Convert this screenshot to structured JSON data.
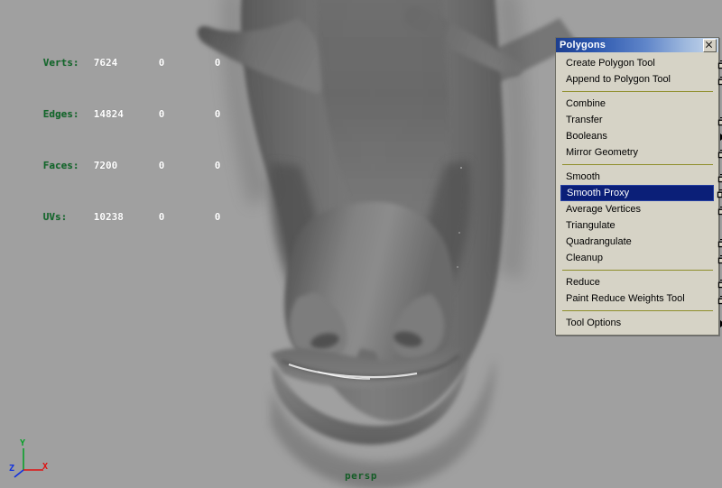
{
  "app": {
    "viewport_background": "#a0a0a0",
    "camera_label": "persp"
  },
  "hud": {
    "rows": [
      {
        "label": "Verts:",
        "v0": "7624",
        "v1": "0",
        "v2": "0"
      },
      {
        "label": "Edges:",
        "v0": "14824",
        "v1": "0",
        "v2": "0"
      },
      {
        "label": "Faces:",
        "v0": "7200",
        "v1": "0",
        "v2": "0"
      },
      {
        "label": "UVs:",
        "v0": "10238",
        "v1": "0",
        "v2": "0"
      }
    ],
    "text_color": "#0d5a22",
    "value_color": "#ffffff"
  },
  "axis_gizmo": {
    "y_label": "Y",
    "x_label": "X",
    "z_label": "Z",
    "y_color": "#0aa02a",
    "x_color": "#e01010",
    "z_color": "#1030e0"
  },
  "menu": {
    "title": "Polygons",
    "close_icon": "close-icon",
    "selected_item": "Smooth Proxy",
    "highlight_color": "#0b1f78",
    "separator_color": "#8e8e2a",
    "background_color": "#d6d3c6",
    "groups": [
      {
        "items": [
          {
            "label": "Create Polygon Tool",
            "option_box": true,
            "submenu": false
          },
          {
            "label": "Append to Polygon Tool",
            "option_box": true,
            "submenu": false
          }
        ]
      },
      {
        "items": [
          {
            "label": "Combine",
            "option_box": false,
            "submenu": false
          },
          {
            "label": "Transfer",
            "option_box": true,
            "submenu": false
          },
          {
            "label": "Booleans",
            "option_box": false,
            "submenu": true
          },
          {
            "label": "Mirror Geometry",
            "option_box": true,
            "submenu": false
          }
        ]
      },
      {
        "items": [
          {
            "label": "Smooth",
            "option_box": true,
            "submenu": false
          },
          {
            "label": "Smooth Proxy",
            "option_box": true,
            "submenu": false,
            "selected": true
          },
          {
            "label": "Average Vertices",
            "option_box": true,
            "submenu": false
          },
          {
            "label": "Triangulate",
            "option_box": false,
            "submenu": false
          },
          {
            "label": "Quadrangulate",
            "option_box": true,
            "submenu": false
          },
          {
            "label": "Cleanup",
            "option_box": true,
            "submenu": false
          }
        ]
      },
      {
        "items": [
          {
            "label": "Reduce",
            "option_box": true,
            "submenu": false
          },
          {
            "label": "Paint Reduce Weights Tool",
            "option_box": true,
            "submenu": false
          }
        ]
      },
      {
        "items": [
          {
            "label": "Tool Options",
            "option_box": false,
            "submenu": true
          }
        ]
      }
    ]
  }
}
